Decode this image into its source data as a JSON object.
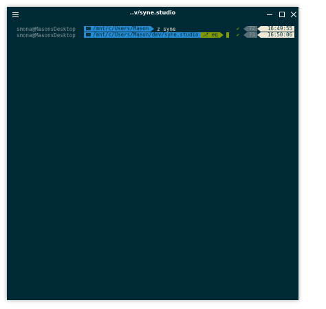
{
  "window": {
    "title": "..v/syne.studio"
  },
  "colors": {
    "background": "#002b36",
    "dir_segment": "#268bd2",
    "git_segment": "#859900",
    "num_segment": "#586e75",
    "time_segment": "#eee8d5"
  },
  "icons": {
    "menu": "hamburger-icon",
    "minimize": "minimize-icon",
    "maximize": "maximize-icon",
    "close": "close-icon",
    "folder": "folder-icon",
    "git": "git-icon",
    "check": "check-icon"
  },
  "prompt_lines": [
    {
      "user": "smona@MasonsDesktop",
      "path": "/mnt/c/Users/Mason",
      "command": "z syne",
      "status": "✔",
      "exit_count": "72",
      "time": "16:49:55"
    },
    {
      "user": "smona@MasonsDesktop",
      "path": "/mnt/c/Users/Mason/dev/syne.studio",
      "git_branch": "eq",
      "git_icon": "⎇",
      "status": "✔",
      "exit_count": "73",
      "time": "16:50:06"
    }
  ]
}
